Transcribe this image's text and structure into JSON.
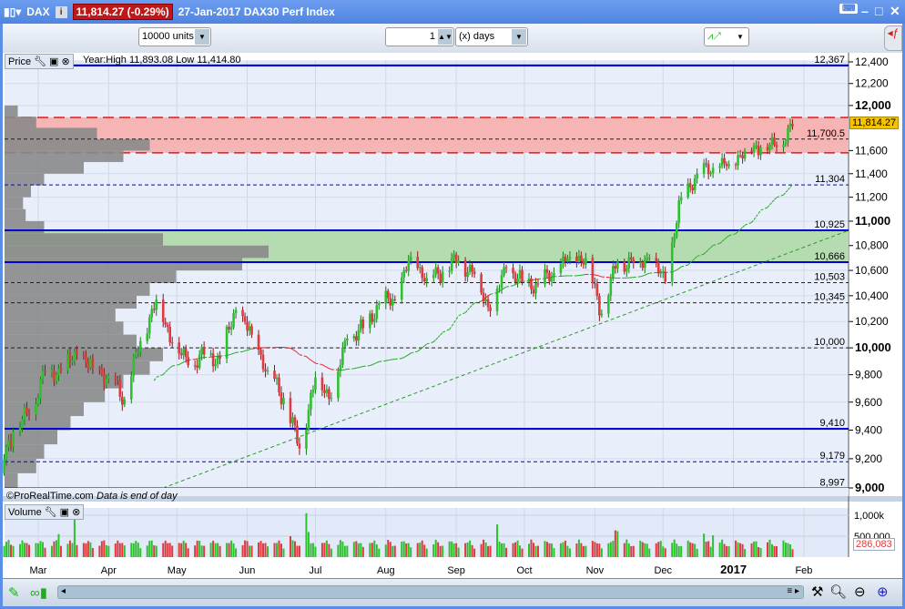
{
  "window": {
    "symbol": "DAX",
    "price_badge": "11,814.27 (-0.29%)",
    "title": "27-Jan-2017 DAX30 Perf Index"
  },
  "toolbar": {
    "units": "10000 units",
    "period_value": "1",
    "period_unit": "(x) days"
  },
  "price_panel": {
    "label": "Price",
    "info": "Year:High 11,893.08 Low 11,414.80",
    "copyright": "©ProRealTime.com",
    "note": "Data is end of day",
    "current_price": "11,814.27",
    "axis_ticks": [
      {
        "v": 12400,
        "t": "12,400"
      },
      {
        "v": 12200,
        "t": "12,200"
      },
      {
        "v": 12000,
        "t": "12,000",
        "bold": true
      },
      {
        "v": 11600,
        "t": "11,600"
      },
      {
        "v": 11400,
        "t": "11,400"
      },
      {
        "v": 11200,
        "t": "11,200"
      },
      {
        "v": 11000,
        "t": "11,000",
        "bold": true
      },
      {
        "v": 10800,
        "t": "10,800"
      },
      {
        "v": 10600,
        "t": "10,600"
      },
      {
        "v": 10400,
        "t": "10,400"
      },
      {
        "v": 10200,
        "t": "10,200"
      },
      {
        "v": 10000,
        "t": "10,000",
        "bold": true
      },
      {
        "v": 9800,
        "t": "9,800"
      },
      {
        "v": 9600,
        "t": "9,600"
      },
      {
        "v": 9400,
        "t": "9,400"
      },
      {
        "v": 9200,
        "t": "9,200"
      },
      {
        "v": 9000,
        "t": "9,000",
        "bold": true
      }
    ],
    "levels": [
      {
        "v": 12367,
        "t": "12,367",
        "style": "solid-blue"
      },
      {
        "v": 11700.5,
        "t": "11,700.5",
        "style": "dash-black"
      },
      {
        "v": 11304,
        "t": "11,304",
        "style": "dash-blue"
      },
      {
        "v": 10925,
        "t": "10,925",
        "style": "solid-blue"
      },
      {
        "v": 10666,
        "t": "10,666",
        "style": "solid-blue"
      },
      {
        "v": 10503,
        "t": "10,503",
        "style": "dash-black"
      },
      {
        "v": 10345,
        "t": "10,345",
        "style": "dash-black"
      },
      {
        "v": 10000,
        "t": "10,000",
        "style": "dash-black"
      },
      {
        "v": 9410,
        "t": "9,410",
        "style": "solid-blue"
      },
      {
        "v": 9179,
        "t": "9,179",
        "style": "dash-blue"
      },
      {
        "v": 8997,
        "t": "8,997",
        "style": "solid-blue"
      }
    ],
    "zones": [
      {
        "from": 11580,
        "to": 11893,
        "color": "#f7b4b4",
        "edge": "#e21b1b"
      },
      {
        "from": 10666,
        "to": 10925,
        "color": "#b5dcb0",
        "edge": null
      }
    ]
  },
  "volume_panel": {
    "label": "Volume",
    "axis_ticks": [
      {
        "v": 1000000,
        "t": "1,000k"
      },
      {
        "v": 500000,
        "t": "500,000"
      }
    ],
    "current": "286,083"
  },
  "months": [
    {
      "t": "Mar",
      "day": 29
    },
    {
      "t": "Apr",
      "day": 60
    },
    {
      "t": "May",
      "day": 90
    },
    {
      "t": "Jun",
      "day": 121
    },
    {
      "t": "Jul",
      "day": 151
    },
    {
      "t": "Aug",
      "day": 182
    },
    {
      "t": "Sep",
      "day": 213
    },
    {
      "t": "Oct",
      "day": 243
    },
    {
      "t": "Nov",
      "day": 274
    },
    {
      "t": "Dec",
      "day": 304
    },
    {
      "t": "2017",
      "day": 335,
      "bold": true
    },
    {
      "t": "Feb",
      "day": 366
    }
  ],
  "chart_data": {
    "type": "candlestick",
    "scale": "log",
    "ylim": [
      9000,
      12400
    ],
    "start": "2016-02-12",
    "weekly_closes": [
      9100,
      9390,
      9510,
      9820,
      9830,
      9950,
      9850,
      9790,
      9620,
      10050,
      10370,
      10040,
      9870,
      9950,
      9920,
      10290,
      10100,
      9830,
      9630,
      9270,
      9780,
      9630,
      10070,
      10150,
      10340,
      10370,
      10710,
      10540,
      10590,
      10680,
      10570,
      10280,
      10620,
      10510,
      10490,
      10580,
      10710,
      10700,
      10260,
      10670,
      10660,
      10700,
      10510,
      11200,
      11400,
      11450,
      11480,
      11600,
      11630,
      11630,
      11814
    ],
    "trendline": [
      {
        "day": 84,
        "price": 9000
      },
      {
        "day": 386,
        "price": 10926
      }
    ],
    "volume_profile": [
      [
        9000,
        0.05
      ],
      [
        9100,
        0.12
      ],
      [
        9200,
        0.15
      ],
      [
        9300,
        0.2
      ],
      [
        9400,
        0.25
      ],
      [
        9500,
        0.3
      ],
      [
        9600,
        0.38
      ],
      [
        9700,
        0.45
      ],
      [
        9800,
        0.55
      ],
      [
        9900,
        0.6
      ],
      [
        10000,
        0.5
      ],
      [
        10100,
        0.45
      ],
      [
        10200,
        0.42
      ],
      [
        10300,
        0.5
      ],
      [
        10400,
        0.55
      ],
      [
        10500,
        0.65
      ],
      [
        10600,
        0.9
      ],
      [
        10700,
        1.0
      ],
      [
        10800,
        0.6
      ],
      [
        10900,
        0.15
      ],
      [
        11000,
        0.08
      ],
      [
        11100,
        0.07
      ],
      [
        11200,
        0.1
      ],
      [
        11300,
        0.15
      ],
      [
        11400,
        0.3
      ],
      [
        11500,
        0.45
      ],
      [
        11600,
        0.55
      ],
      [
        11700,
        0.35
      ],
      [
        11800,
        0.12
      ],
      [
        11900,
        0.05
      ]
    ],
    "volume_spikes": [
      {
        "day": 38,
        "v": 550000
      },
      {
        "day": 45,
        "v": 900000
      },
      {
        "day": 140,
        "v": 500000
      },
      {
        "day": 147,
        "v": 1050000
      },
      {
        "day": 148,
        "v": 600000
      },
      {
        "day": 231,
        "v": 780000
      },
      {
        "day": 283,
        "v": 640000
      },
      {
        "day": 284,
        "v": 620000
      },
      {
        "day": 322,
        "v": 560000
      },
      {
        "day": 326,
        "v": 520000
      },
      {
        "day": 327,
        "v": 770000
      }
    ]
  },
  "colors": {
    "up": "#2ec12e",
    "down": "#e0393e",
    "level_blue": "#0000d8",
    "accent_yellow": "#f5c400"
  }
}
